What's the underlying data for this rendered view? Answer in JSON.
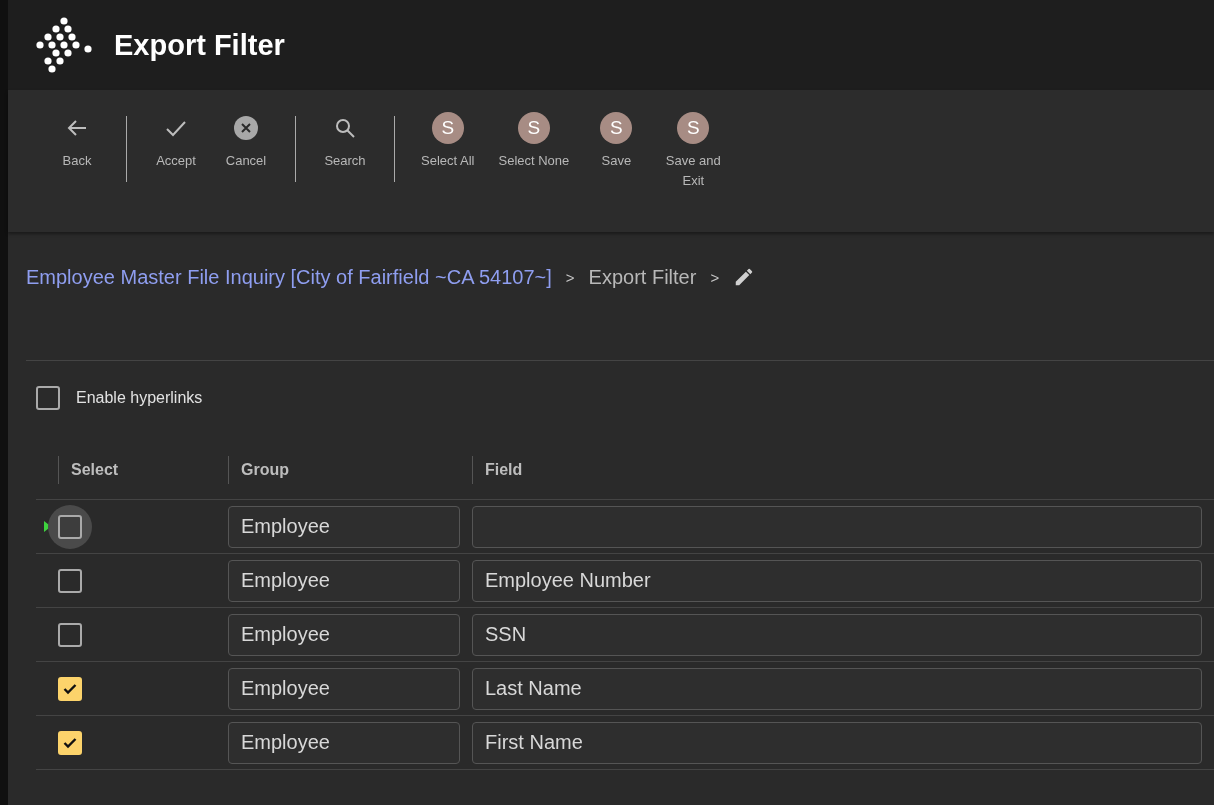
{
  "window": {
    "title": "Export Filter"
  },
  "toolbar": {
    "groups": [
      [
        {
          "kind": "back",
          "label": "Back"
        }
      ],
      [
        {
          "kind": "accept",
          "label": "Accept"
        },
        {
          "kind": "cancel",
          "label": "Cancel"
        }
      ],
      [
        {
          "kind": "search",
          "label": "Search"
        }
      ],
      [
        {
          "kind": "letter",
          "badge": "S",
          "label": "Select All"
        },
        {
          "kind": "letter",
          "badge": "S",
          "label": "Select None"
        },
        {
          "kind": "letter",
          "badge": "S",
          "label": "Save"
        },
        {
          "kind": "letter",
          "badge": "S",
          "label": "Save and Exit"
        }
      ]
    ]
  },
  "breadcrumb": {
    "items": [
      {
        "label": "Employee Master File Inquiry [City of Fairfield ~CA 54107~]",
        "kind": "link"
      },
      {
        "label": ">",
        "kind": "sep"
      },
      {
        "label": "Export Filter",
        "kind": "current"
      },
      {
        "label": ">",
        "kind": "sep"
      }
    ]
  },
  "enable_hyperlinks": {
    "label": "Enable hyperlinks",
    "checked": false
  },
  "table": {
    "columns": [
      "Select",
      "Group",
      "Field"
    ],
    "rows": [
      {
        "selected": true,
        "checked": false,
        "group": "Employee",
        "field": ""
      },
      {
        "selected": false,
        "checked": false,
        "group": "Employee",
        "field": "Employee Number"
      },
      {
        "selected": false,
        "checked": false,
        "group": "Employee",
        "field": "SSN"
      },
      {
        "selected": false,
        "checked": true,
        "group": "Employee",
        "field": "Last Name"
      },
      {
        "selected": false,
        "checked": true,
        "group": "Employee",
        "field": "First Name"
      }
    ]
  }
}
